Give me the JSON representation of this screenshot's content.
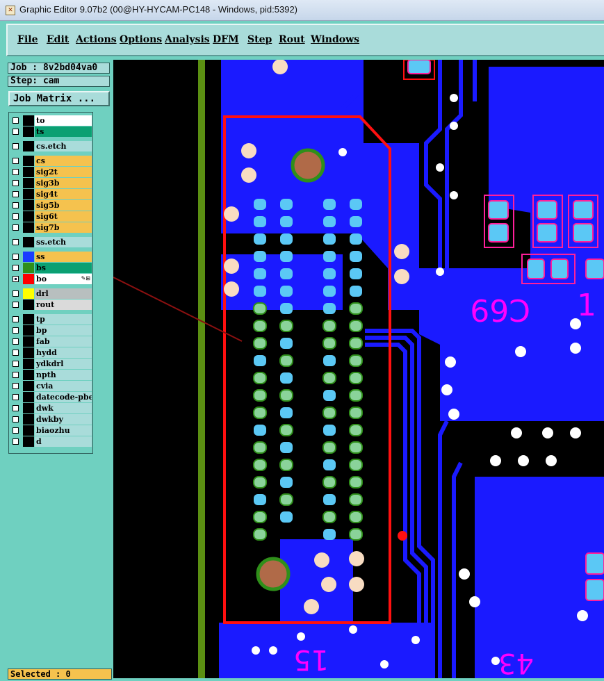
{
  "window": {
    "title": "Graphic Editor 9.07b2 (00@HY-HYCAM-PC148 - Windows, pid:5392)"
  },
  "menu": [
    "File",
    "Edit",
    "Actions",
    "Options",
    "Analysis",
    "DFM",
    "Step",
    "Rout",
    "Windows"
  ],
  "job": {
    "label": "Job : 8v2bd04va0",
    "step": "Step: cam"
  },
  "job_matrix_button": "Job Matrix ...",
  "layers": [
    {
      "name": "to",
      "bg": "#ffffff",
      "swatch": "#000000",
      "group": 0
    },
    {
      "name": "ts",
      "bg": "#0ba072",
      "swatch": "#000000",
      "group": 0
    },
    {
      "name": "cs.etch",
      "bg": "#a9dcda",
      "swatch": "#000000",
      "group": 1
    },
    {
      "name": "cs",
      "bg": "#f5c24e",
      "swatch": "#000000",
      "group": 2
    },
    {
      "name": "sig2t",
      "bg": "#f5c24e",
      "swatch": "#000000",
      "group": 2
    },
    {
      "name": "sig3b",
      "bg": "#f5c24e",
      "swatch": "#000000",
      "group": 2
    },
    {
      "name": "sig4t",
      "bg": "#f5c24e",
      "swatch": "#000000",
      "group": 2
    },
    {
      "name": "sig5b",
      "bg": "#f5c24e",
      "swatch": "#000000",
      "group": 2
    },
    {
      "name": "sig6t",
      "bg": "#f5c24e",
      "swatch": "#000000",
      "group": 2
    },
    {
      "name": "sig7b",
      "bg": "#f5c24e",
      "swatch": "#000000",
      "group": 2
    },
    {
      "name": "ss.etch",
      "bg": "#a9dcda",
      "swatch": "#000000",
      "group": 3
    },
    {
      "name": "ss",
      "bg": "#f5c24e",
      "swatch": "#1a3cff",
      "group": 4
    },
    {
      "name": "bs",
      "bg": "#0ba072",
      "swatch": "#2f8f1a",
      "group": 4
    },
    {
      "name": "bo",
      "bg": "#ffffff",
      "swatch": "#ff0000",
      "group": 4,
      "active": true
    },
    {
      "name": "drl",
      "bg": "#b8bfbf",
      "swatch": "#ffff00",
      "group": 5
    },
    {
      "name": "rout",
      "bg": "#dadada",
      "swatch": "#000000",
      "group": 5
    },
    {
      "name": "tp",
      "bg": "#a9dcda",
      "swatch": "#000000",
      "group": 6
    },
    {
      "name": "bp",
      "bg": "#a9dcda",
      "swatch": "#000000",
      "group": 6
    },
    {
      "name": "fab",
      "bg": "#a9dcda",
      "swatch": "#000000",
      "group": 6
    },
    {
      "name": "hydd",
      "bg": "#a9dcda",
      "swatch": "#000000",
      "group": 6
    },
    {
      "name": "ydkdrl",
      "bg": "#a9dcda",
      "swatch": "#000000",
      "group": 6
    },
    {
      "name": "npth",
      "bg": "#a9dcda",
      "swatch": "#000000",
      "group": 6
    },
    {
      "name": "cvia",
      "bg": "#a9dcda",
      "swatch": "#000000",
      "group": 6
    },
    {
      "name": "datecode-pbe",
      "bg": "#a9dcda",
      "swatch": "#000000",
      "group": 6
    },
    {
      "name": "dwk",
      "bg": "#a9dcda",
      "swatch": "#000000",
      "group": 6
    },
    {
      "name": "dwkby",
      "bg": "#a9dcda",
      "swatch": "#000000",
      "group": 6
    },
    {
      "name": "biaozhu",
      "bg": "#a9dcda",
      "swatch": "#000000",
      "group": 6
    },
    {
      "name": "d",
      "bg": "#a9dcda",
      "swatch": "#000000",
      "group": 6
    }
  ],
  "status": {
    "selected": "Selected : 0"
  },
  "canvas": {
    "silk_text": [
      "C69",
      "1",
      "15",
      "43"
    ]
  },
  "colors": {
    "copper": "#1a1aff",
    "pad": "#5bc8f5",
    "silk": "#ff00ff",
    "outline": "#ff0000",
    "panel": "#6fd0c0",
    "menu": "#a9dcda"
  }
}
